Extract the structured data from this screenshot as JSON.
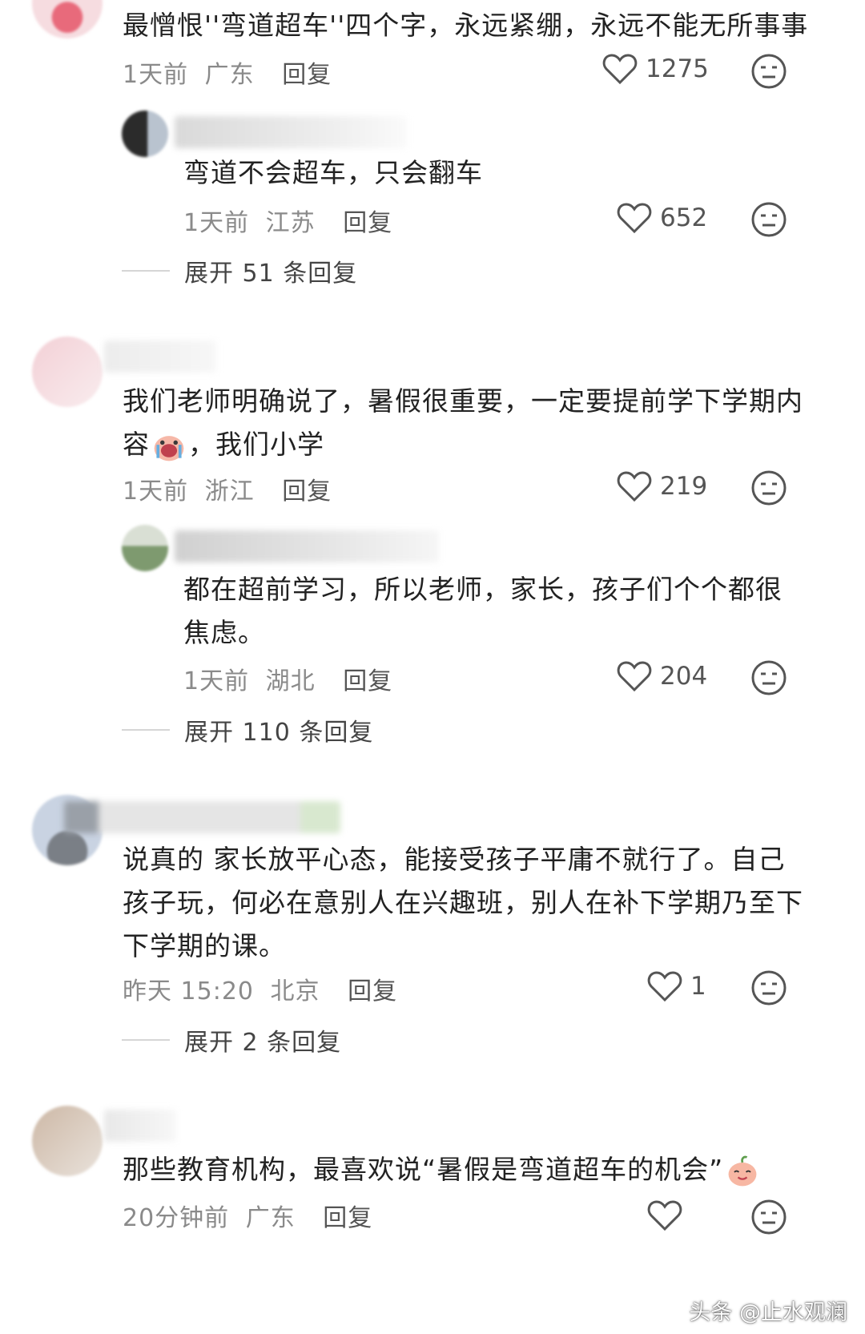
{
  "comments": [
    {
      "text": "最憎恨''弯道超车''四个字，永远紧绷，永远不能无所事事",
      "time": "1天前",
      "location": "广东",
      "reply_label": "回复",
      "likes": "1275"
    },
    {
      "text": "弯道不会超车，只会翻车",
      "time": "1天前",
      "location": "江苏",
      "reply_label": "回复",
      "likes": "652",
      "expand_label": "展开 51 条回复"
    },
    {
      "text_line1": "我们老师明确说了，暑假很重要，一定要提前学下学期内",
      "text_line2a": "容",
      "text_line2b": "，我们小学",
      "time": "1天前",
      "location": "浙江",
      "reply_label": "回复",
      "likes": "219"
    },
    {
      "text_line1": "都在超前学习，所以老师，家长，孩子们个个都很",
      "text_line2": "焦虑。",
      "time": "1天前",
      "location": "湖北",
      "reply_label": "回复",
      "likes": "204",
      "expand_label": "展开 110 条回复"
    },
    {
      "text_line1": "说真的 家长放平心态，能接受孩子平庸不就行了。自己",
      "text_line2": "孩子玩，何必在意别人在兴趣班，别人在补下学期乃至下",
      "text_line3": "下学期的课。",
      "time": "昨天 15:20",
      "location": "北京",
      "reply_label": "回复",
      "likes": "1",
      "expand_label": "展开 2 条回复"
    },
    {
      "text": "那些教育机构，最喜欢说“暑假是弯道超车的机会”",
      "time": "20分钟前",
      "location": "广东",
      "reply_label": "回复"
    }
  ],
  "icons": {
    "like": "heart-icon",
    "dislike": "meh-face-icon",
    "emoji_crying": "crying-face-emoji",
    "emoji_peach": "peach-face-emoji"
  },
  "watermark": "头条 @止水观澜",
  "colors": {
    "text": "#222222",
    "meta": "#8a8a8a",
    "icon": "#555555"
  }
}
